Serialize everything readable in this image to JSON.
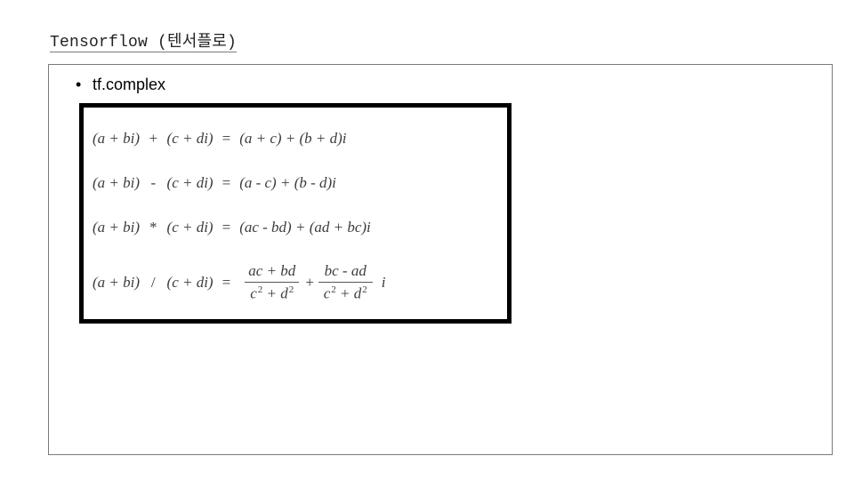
{
  "title": "Tensorflow (텐서플로)",
  "bullet": "tf.complex",
  "formulas": {
    "lhs_a": "(a  +  bi)",
    "lhs_b": "(c  +  di)",
    "add": {
      "op": "+",
      "rhs": "(a  +  c)  +  (b  +  d)i"
    },
    "sub": {
      "op": "-",
      "rhs": "(a  -  c)  +  (b  -  d)i"
    },
    "mul": {
      "op": "*",
      "rhs": "(ac  -  bd)  +  (ad  +  bc)i"
    },
    "div": {
      "op": "/",
      "frac1": {
        "num": "ac  +  bd",
        "den_c": "c",
        "den_p": "2",
        "den_mid": "  +  ",
        "den_d": "d",
        "den_p2": "2"
      },
      "plus": "  +  ",
      "frac2": {
        "num": "bc  -  ad",
        "den_c": "c",
        "den_p": "2",
        "den_mid": "  +  ",
        "den_d": "d",
        "den_p2": "2"
      },
      "tail": " i"
    }
  }
}
